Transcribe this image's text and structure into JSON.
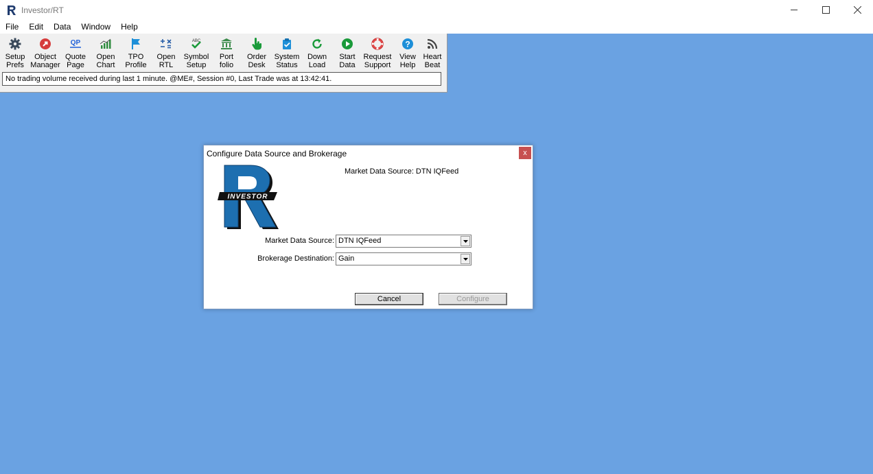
{
  "window": {
    "title": "Investor/RT"
  },
  "menu": [
    "File",
    "Edit",
    "Data",
    "Window",
    "Help"
  ],
  "toolbar": [
    {
      "label": "Setup\nPrefs",
      "icon": "gear-icon"
    },
    {
      "label": "Object\nManager",
      "icon": "object-manager-icon"
    },
    {
      "label": "Quote\nPage",
      "icon": "qp-icon"
    },
    {
      "label": "Open\nChart",
      "icon": "bar-chart-icon"
    },
    {
      "label": "TPO\nProfile",
      "icon": "flag-icon"
    },
    {
      "label": "Open\nRTL",
      "icon": "rtl-formula-icon"
    },
    {
      "label": "Symbol\nSetup",
      "icon": "abc-check-icon"
    },
    {
      "label": "Port\nfolio",
      "icon": "bank-icon"
    },
    {
      "label": "Order\nDesk",
      "icon": "hand-pointer-icon"
    },
    {
      "label": "System\nStatus",
      "icon": "clipboard-check-icon"
    },
    {
      "label": "Down\nLoad",
      "icon": "refresh-icon"
    },
    {
      "label": "Start\nData",
      "icon": "play-icon"
    },
    {
      "label": "Request\nSupport",
      "icon": "lifebuoy-icon"
    },
    {
      "label": "View\nHelp",
      "icon": "help-icon"
    },
    {
      "label": "Heart\nBeat",
      "icon": "rss-icon"
    }
  ],
  "status": {
    "message": "No trading volume received during last 1 minute.  @ME#, Session #0, Last Trade was at 13:42:41."
  },
  "dialog": {
    "title": "Configure Data Source and Brokerage",
    "close_label": "x",
    "summary": "Market Data Source:  DTN IQFeed",
    "logo_text": "INVESTOR",
    "market_data_label": "Market Data Source:",
    "market_data_value": "DTN IQFeed",
    "brokerage_label": "Brokerage Destination:",
    "brokerage_value": "Gain",
    "cancel_label": "Cancel",
    "configure_label": "Configure"
  },
  "colors": {
    "desktop": "#6aa2e2",
    "accent_green": "#1a9a3a",
    "accent_red": "#d63c3c",
    "accent_blue": "#1d8fd8"
  }
}
